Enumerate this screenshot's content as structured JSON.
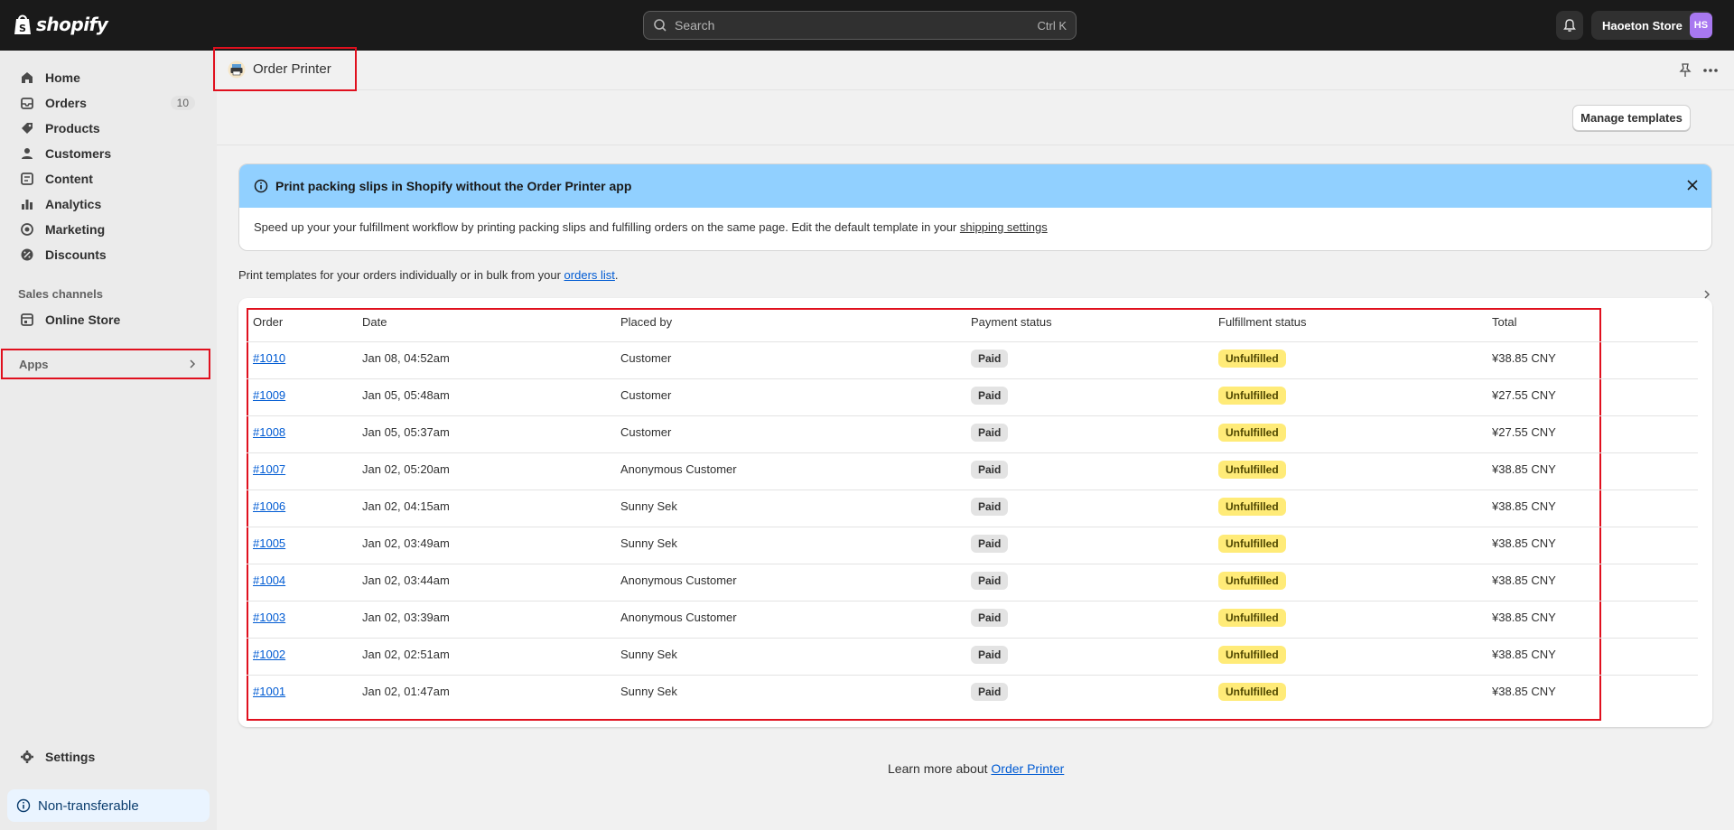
{
  "topbar": {
    "logo_text": "shopify",
    "search_placeholder": "Search",
    "search_shortcut": "Ctrl K",
    "store_name": "Haoeton Store",
    "avatar_initials": "HS"
  },
  "sidebar": {
    "items": [
      {
        "label": "Home",
        "icon": "home-icon"
      },
      {
        "label": "Orders",
        "icon": "orders-icon",
        "badge": "10"
      },
      {
        "label": "Products",
        "icon": "tag-icon"
      },
      {
        "label": "Customers",
        "icon": "person-icon"
      },
      {
        "label": "Content",
        "icon": "content-icon"
      },
      {
        "label": "Analytics",
        "icon": "bar-chart-icon"
      },
      {
        "label": "Marketing",
        "icon": "target-icon"
      },
      {
        "label": "Discounts",
        "icon": "discount-icon"
      }
    ],
    "sales_channels_label": "Sales channels",
    "online_store_label": "Online Store",
    "apps_label": "Apps",
    "settings_label": "Settings",
    "non_transferable_label": "Non-transferable"
  },
  "page": {
    "app_title": "Order Printer",
    "manage_templates_label": "Manage templates"
  },
  "banner": {
    "title": "Print packing slips in Shopify without the Order Printer app",
    "body_text": "Speed up your your fulfillment workflow by printing packing slips and fulfilling orders on the same page. Edit the default template in your ",
    "body_link": "shipping settings"
  },
  "intro": {
    "text": "Print templates for your orders individually or in bulk from your ",
    "link": "orders list",
    "suffix": "."
  },
  "table": {
    "headers": [
      "Order",
      "Date",
      "Placed by",
      "Payment status",
      "Fulfillment status",
      "Total"
    ],
    "rows": [
      {
        "order": "#1010",
        "date": "Jan 08, 04:52am",
        "placed_by": "Customer",
        "payment": "Paid",
        "fulfillment": "Unfulfilled",
        "total": "¥38.85 CNY"
      },
      {
        "order": "#1009",
        "date": "Jan 05, 05:48am",
        "placed_by": "Customer",
        "payment": "Paid",
        "fulfillment": "Unfulfilled",
        "total": "¥27.55 CNY"
      },
      {
        "order": "#1008",
        "date": "Jan 05, 05:37am",
        "placed_by": "Customer",
        "payment": "Paid",
        "fulfillment": "Unfulfilled",
        "total": "¥27.55 CNY"
      },
      {
        "order": "#1007",
        "date": "Jan 02, 05:20am",
        "placed_by": "Anonymous Customer",
        "payment": "Paid",
        "fulfillment": "Unfulfilled",
        "total": "¥38.85 CNY"
      },
      {
        "order": "#1006",
        "date": "Jan 02, 04:15am",
        "placed_by": "Sunny Sek",
        "payment": "Paid",
        "fulfillment": "Unfulfilled",
        "total": "¥38.85 CNY"
      },
      {
        "order": "#1005",
        "date": "Jan 02, 03:49am",
        "placed_by": "Sunny Sek",
        "payment": "Paid",
        "fulfillment": "Unfulfilled",
        "total": "¥38.85 CNY"
      },
      {
        "order": "#1004",
        "date": "Jan 02, 03:44am",
        "placed_by": "Anonymous Customer",
        "payment": "Paid",
        "fulfillment": "Unfulfilled",
        "total": "¥38.85 CNY"
      },
      {
        "order": "#1003",
        "date": "Jan 02, 03:39am",
        "placed_by": "Anonymous Customer",
        "payment": "Paid",
        "fulfillment": "Unfulfilled",
        "total": "¥38.85 CNY"
      },
      {
        "order": "#1002",
        "date": "Jan 02, 02:51am",
        "placed_by": "Sunny Sek",
        "payment": "Paid",
        "fulfillment": "Unfulfilled",
        "total": "¥38.85 CNY"
      },
      {
        "order": "#1001",
        "date": "Jan 02, 01:47am",
        "placed_by": "Sunny Sek",
        "payment": "Paid",
        "fulfillment": "Unfulfilled",
        "total": "¥38.85 CNY"
      }
    ]
  },
  "footer": {
    "learn_text": "Learn more about ",
    "learn_link": "Order Printer"
  },
  "colors": {
    "topbar_bg": "#1a1a1a",
    "banner_bg": "#91d0ff",
    "link": "#005bd3",
    "unfulfilled_bg": "#ffeb78",
    "highlight_border": "#e0101e"
  }
}
